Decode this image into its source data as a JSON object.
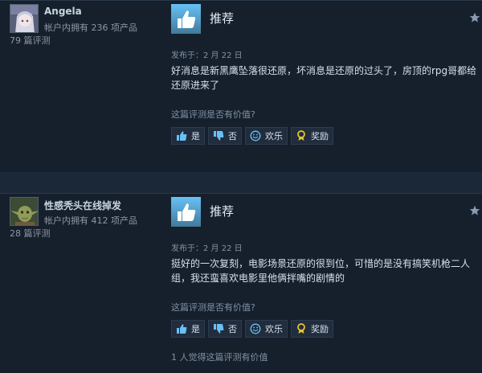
{
  "reviews": [
    {
      "author": "Angela",
      "products_owned": "帐户内拥有 236 项产品",
      "review_count": "79 篇评测",
      "verdict": "推荐",
      "posted": "发布于：2 月 22 日",
      "text": "好消息是新黑鹰坠落很还原，坏消息是还原的过头了，房顶的rpg哥都给还原进来了",
      "helpful_question": "这篇评测是否有价值?",
      "buttons": {
        "yes": "是",
        "no": "否",
        "funny": "欢乐",
        "award": "奖励"
      },
      "helpful_count": ""
    },
    {
      "author": "性感秃头在线掉发",
      "products_owned": "帐户内拥有 412 项产品",
      "review_count": "28 篇评测",
      "verdict": "推荐",
      "posted": "发布于：2 月 22 日",
      "text": "挺好的一次复刻，电影场景还原的很到位，可惜的是没有搞笑机枪二人组，我还蛮喜欢电影里他俩拌嘴的剧情的",
      "helpful_question": "这篇评测是否有价值?",
      "buttons": {
        "yes": "是",
        "no": "否",
        "funny": "欢乐",
        "award": "奖励"
      },
      "helpful_count": "1 人觉得这篇评测有价值"
    }
  ],
  "colors": {
    "background": "#1b2838",
    "card": "#16202d",
    "thumb_blue": "#67c1f5",
    "award_yellow": "#e8c430"
  },
  "icons": [
    "avatar-anime-icon",
    "avatar-yoda-icon",
    "thumbs-up-icon",
    "star-icon",
    "thumbs-down-icon",
    "smiley-icon",
    "award-ribbon-icon"
  ]
}
